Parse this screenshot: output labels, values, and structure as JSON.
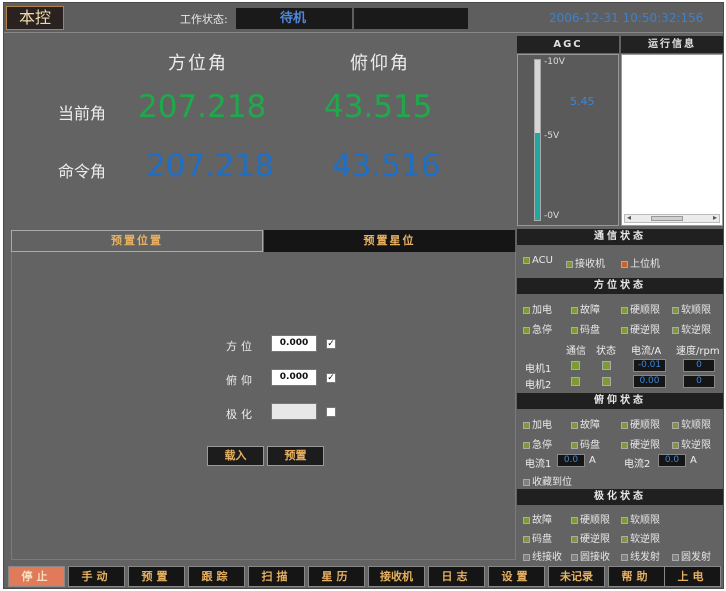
{
  "topbar": {
    "mode_label": "本控",
    "work_state_label": "工作状态:",
    "work_state_value": "待机",
    "datetime": "2006-12-31  10:50:32:156"
  },
  "angles": {
    "azimuth_header": "方位角",
    "elevation_header": "俯仰角",
    "current_label": "当前角",
    "command_label": "命令角",
    "current_azimuth": "207.218",
    "current_elevation": "43.515",
    "command_azimuth": "207.218",
    "command_elevation": "43.516"
  },
  "agc": {
    "title": "AGC",
    "tick_top": "-10V",
    "tick_mid": "-5V",
    "tick_bottom": "-0V",
    "value": "5.45",
    "level_fraction": 0.545
  },
  "run_info": {
    "title": "运行信息",
    "scroll_left": "◂",
    "scroll_right": "▸"
  },
  "preset": {
    "tab_position": "预置位置",
    "tab_star": "预置星位",
    "azimuth_label": "方位",
    "azimuth_value": "0.000",
    "elevation_label": "俯仰",
    "elevation_value": "0.000",
    "polarization_label": "极化",
    "polarization_value": "",
    "check_mark": "✓",
    "load_button": "载入",
    "preset_button": "预置"
  },
  "comm_status": {
    "title": "通信状态",
    "items": [
      "ACU",
      "接收机",
      "上位机"
    ]
  },
  "azimuth_status": {
    "title": "方位状态",
    "row1": [
      "加电",
      "故障",
      "硬顺限",
      "软顺限"
    ],
    "row2": [
      "急停",
      "码盘",
      "硬逆限",
      "软逆限"
    ],
    "col_comm": "通信",
    "col_state": "状态",
    "col_current": "电流/A",
    "col_speed": "速度/rpm",
    "motor1_label": "电机1",
    "motor2_label": "电机2",
    "motor1_current": "-0.01",
    "motor1_speed": "0",
    "motor2_current": "0.00",
    "motor2_speed": "0"
  },
  "elevation_status": {
    "title": "俯仰状态",
    "row1": [
      "加电",
      "故障",
      "硬顺限",
      "软顺限"
    ],
    "row2": [
      "急停",
      "码盘",
      "硬逆限",
      "软逆限"
    ],
    "current1_label": "电流1",
    "current1_value": "0.0",
    "current2_label": "电流2",
    "current2_value": "0.0",
    "unit": "A",
    "stow_label": "收藏到位"
  },
  "polarization_status": {
    "title": "极化状态",
    "row1": [
      "故障",
      "硬顺限",
      "软顺限"
    ],
    "row2": [
      "码盘",
      "硬逆限",
      "软逆限"
    ],
    "row3": [
      "线接收",
      "圆接收",
      "线发射",
      "圆发射"
    ]
  },
  "nav": [
    "停止",
    "手动",
    "预置",
    "跟踪",
    "扫描",
    "星历",
    "接收机",
    "日志",
    "设置",
    "未记录",
    "帮助",
    "上电"
  ]
}
